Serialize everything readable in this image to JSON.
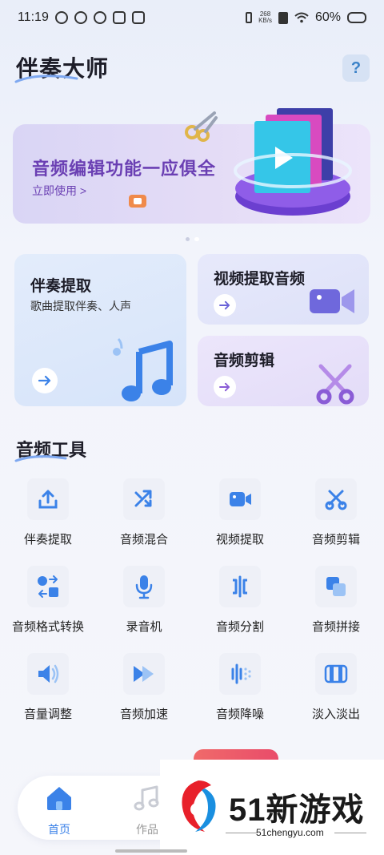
{
  "status": {
    "time": "11:19",
    "net_speed_top": "268",
    "net_speed_unit": "KB/s",
    "battery": "60%"
  },
  "header": {
    "title": "伴奏大师",
    "help": "?"
  },
  "banner": {
    "title": "音频编辑功能一应俱全",
    "cta": "立即使用 >"
  },
  "cards": {
    "accomp": {
      "title": "伴奏提取",
      "subtitle": "歌曲提取伴奏、人声"
    },
    "video": {
      "title": "视频提取音频"
    },
    "clip": {
      "title": "音频剪辑"
    }
  },
  "section": {
    "title": "音频工具"
  },
  "tools": [
    {
      "label": "伴奏提取",
      "icon": "upload-icon"
    },
    {
      "label": "音频混合",
      "icon": "shuffle-icon"
    },
    {
      "label": "视频提取",
      "icon": "video-camera-icon"
    },
    {
      "label": "音频剪辑",
      "icon": "scissors-icon"
    },
    {
      "label": "音频格式转换",
      "icon": "format-convert-icon"
    },
    {
      "label": "录音机",
      "icon": "microphone-icon"
    },
    {
      "label": "音频分割",
      "icon": "split-icon"
    },
    {
      "label": "音频拼接",
      "icon": "join-icon"
    },
    {
      "label": "音量调整",
      "icon": "volume-icon"
    },
    {
      "label": "音频加速",
      "icon": "fast-forward-icon"
    },
    {
      "label": "音频降噪",
      "icon": "noise-reduction-icon"
    },
    {
      "label": "淡入淡出",
      "icon": "fade-icon"
    }
  ],
  "tabs": {
    "home": "首页",
    "works": "作品"
  },
  "watermark": {
    "brand": "51新游戏",
    "url": "51chengyu.com"
  },
  "colors": {
    "accent": "#3b82e8",
    "banner_text": "#6a3fb3"
  }
}
